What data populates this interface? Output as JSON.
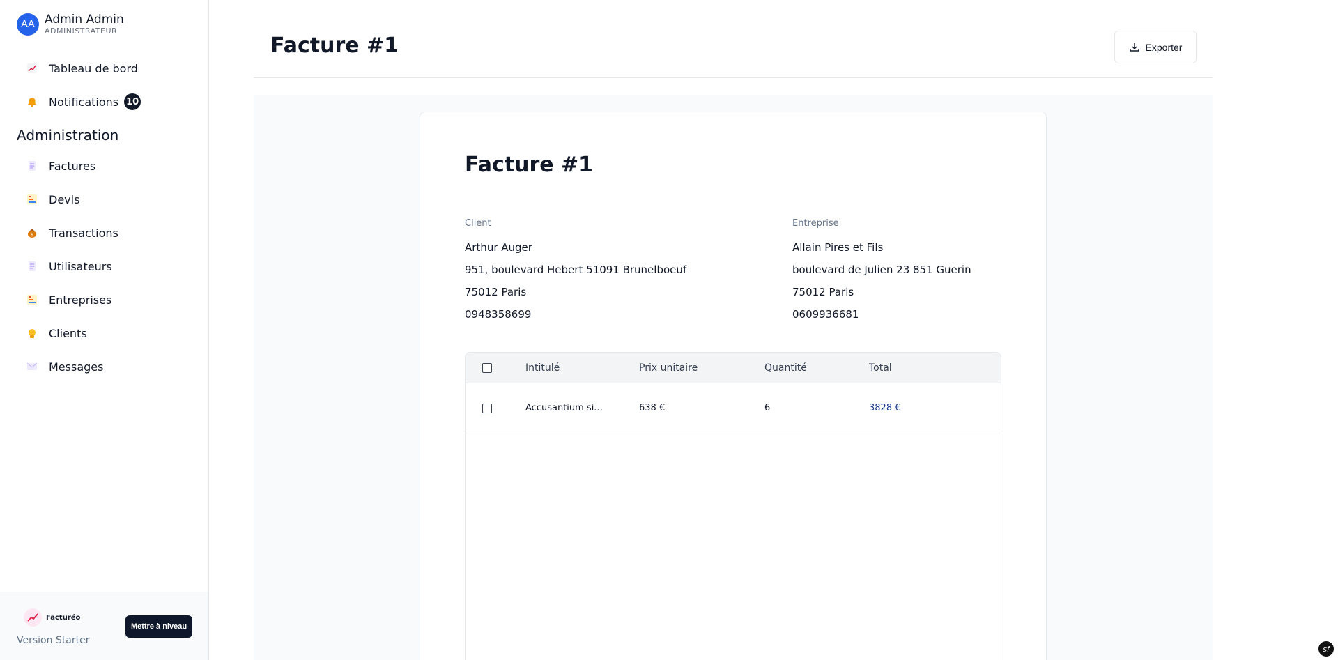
{
  "user": {
    "initials": "AA",
    "name": "Admin Admin",
    "role": "ADMINISTRATEUR"
  },
  "nav": {
    "dashboard": {
      "label": "Tableau de bord",
      "icon": "chart-icon"
    },
    "notifications": {
      "label": "Notifications",
      "count": "10",
      "icon": "bell-icon"
    },
    "section_title": "Administration",
    "items": [
      {
        "label": "Factures",
        "icon": "document-icon"
      },
      {
        "label": "Devis",
        "icon": "bar-chart-icon"
      },
      {
        "label": "Transactions",
        "icon": "money-bag-icon"
      },
      {
        "label": "Utilisateurs",
        "icon": "document-icon"
      },
      {
        "label": "Entreprises",
        "icon": "bar-chart-icon"
      },
      {
        "label": "Clients",
        "icon": "person-icon"
      },
      {
        "label": "Messages",
        "icon": "envelope-icon"
      }
    ]
  },
  "footer": {
    "brand": "Facturéo",
    "version": "Version Starter",
    "upgrade_label": "Mettre à niveau"
  },
  "header": {
    "title": "Facture #1",
    "export_label": "Exporter"
  },
  "invoice": {
    "title": "Facture #1",
    "client": {
      "label": "Client",
      "name": "Arthur Auger",
      "address": "951, boulevard Hebert 51091 Brunelboeuf",
      "city": "75012 Paris",
      "phone": "0948358699"
    },
    "company": {
      "label": "Entreprise",
      "name": "Allain Pires et Fils",
      "address": "boulevard de Julien 23 851 Guerin",
      "city": "75012 Paris",
      "phone": "0609936681"
    },
    "table": {
      "headers": {
        "item": "Intitulé",
        "unit_price": "Prix unitaire",
        "quantity": "Quantité",
        "total": "Total"
      },
      "rows": [
        {
          "item": "Accusantium si...",
          "unit_price": "638 €",
          "quantity": "6",
          "total": "3828 €"
        }
      ]
    }
  },
  "colors": {
    "accent": "#2563eb",
    "dark": "#0f172a",
    "muted": "#64748b",
    "total_text": "#1e3a8a"
  },
  "symfony_badge": "sf"
}
